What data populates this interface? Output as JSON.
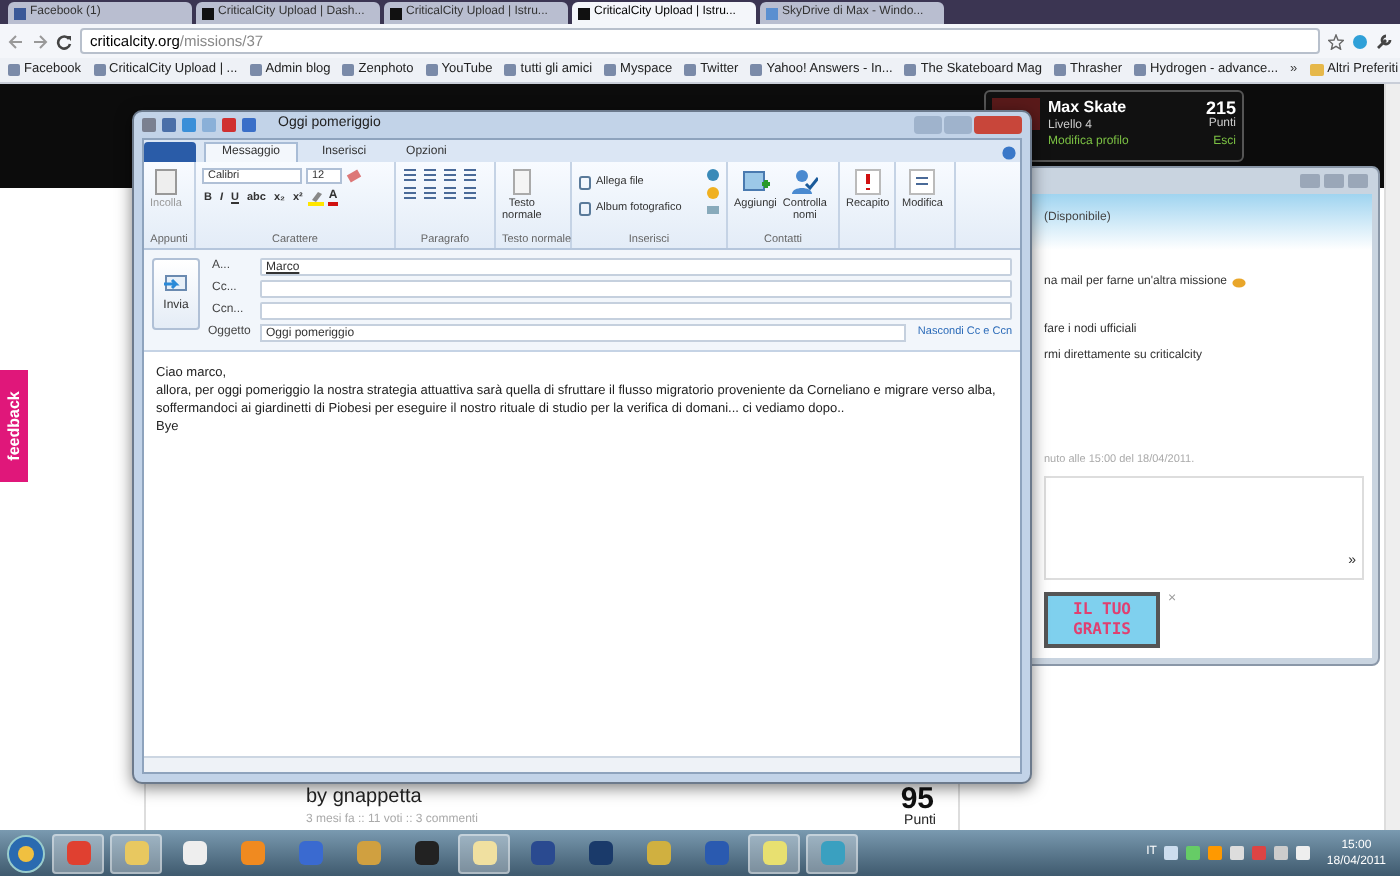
{
  "browser": {
    "tabs": [
      {
        "label": "Facebook (1)",
        "selected": false
      },
      {
        "label": "CriticalCity Upload | Dash...",
        "selected": false
      },
      {
        "label": "CriticalCity Upload | Istru...",
        "selected": false
      },
      {
        "label": "CriticalCity Upload | Istru...",
        "selected": true
      },
      {
        "label": "SkyDrive di Max - Windo...",
        "selected": false
      }
    ],
    "address": {
      "host": "criticalcity.org",
      "path": "/missions/37"
    },
    "bookmarks": [
      "Facebook",
      "CriticalCity Upload | ...",
      "Admin blog",
      "Zenphoto",
      "YouTube",
      "tutti gli amici",
      "Myspace",
      "Twitter",
      "Yahoo! Answers - In...",
      "The Skateboard Mag",
      "Thrasher",
      "Hydrogen - advance..."
    ],
    "bookmarks_more": "»",
    "other_bookmarks": "Altri Preferiti"
  },
  "page": {
    "feedback": "feedback",
    "profile": {
      "name": "Max Skate",
      "level": "Livello 4",
      "edit": "Modifica profilo",
      "points": "215",
      "points_label": "Punti",
      "logout": "Esci"
    },
    "mission": {
      "author": "by gnappetta",
      "meta": "3 mesi fa :: 11 voti :: 3 commenti",
      "points": "95",
      "points_label": "Punti"
    }
  },
  "messenger": {
    "status": "(Disponibile)",
    "lines": [
      "na mail per farne un'altra missione",
      "fare i nodi ufficiali",
      "rmi direttamente su criticalcity"
    ],
    "received": "nuto alle 15:00 del 18/04/2011.",
    "more": "»",
    "ad": [
      "IL TUO",
      "GRATIS"
    ],
    "ad_close": "×"
  },
  "mail": {
    "title": "Oggi pomeriggio",
    "tabs": [
      {
        "label": "Messaggio",
        "selected": true
      },
      {
        "label": "Inserisci",
        "selected": false
      },
      {
        "label": "Opzioni",
        "selected": false
      }
    ],
    "ribbon": {
      "paste": "Incolla",
      "clipboard": "Appunti",
      "font": "Calibri",
      "size": "12",
      "format_buttons": [
        "B",
        "I",
        "U",
        "abc",
        "x₂",
        "x²"
      ],
      "font_color": "A",
      "font_group": "Carattere",
      "paragraph": "Paragrafo",
      "plain_text": "Testo normale",
      "plain_text_group": "Testo normale",
      "attach": "Allega file",
      "album": "Album fotografico",
      "insert_group": "Inserisci",
      "add": "Aggiungi",
      "check_names": "Controlla nomi",
      "contacts_group": "Contatti",
      "delivery": "Recapito",
      "edit": "Modifica"
    },
    "send": "Invia",
    "fields": [
      {
        "label": "A...",
        "value": "Marco"
      },
      {
        "label": "Cc..."
      },
      {
        "label": "Ccn..."
      }
    ],
    "subject": {
      "label": "Oggetto",
      "value": "Oggi pomeriggio"
    },
    "hide_cc": "Nascondi Cc e Ccn",
    "body": [
      "Ciao marco,",
      "allora, per oggi pomeriggio la nostra strategia attuattiva sarà quella di sfruttare il flusso migratorio proveniente da Corneliano e migrare verso alba, soffermandoci ai giardinetti di Piobesi per eseguire il nostro rituale di studio per la verifica di domani... ci vediamo dopo..",
      "Bye"
    ]
  },
  "taskbar": {
    "apps": [
      {
        "kind": "browser",
        "selected": true
      },
      {
        "kind": "folder",
        "selected": true
      },
      {
        "kind": "document",
        "selected": false
      },
      {
        "kind": "player",
        "selected": false
      },
      {
        "kind": "music",
        "selected": false
      },
      {
        "kind": "note",
        "selected": false
      },
      {
        "kind": "camera",
        "selected": false
      },
      {
        "kind": "mail",
        "selected": true
      },
      {
        "kind": "dev",
        "selected": false
      },
      {
        "kind": "photoshop",
        "selected": false
      },
      {
        "kind": "pen",
        "selected": false
      },
      {
        "kind": "word",
        "selected": false
      },
      {
        "kind": "notes",
        "selected": true
      },
      {
        "kind": "messenger",
        "selected": true
      }
    ],
    "lang": "IT",
    "time": "15:00",
    "date": "18/04/2011"
  }
}
